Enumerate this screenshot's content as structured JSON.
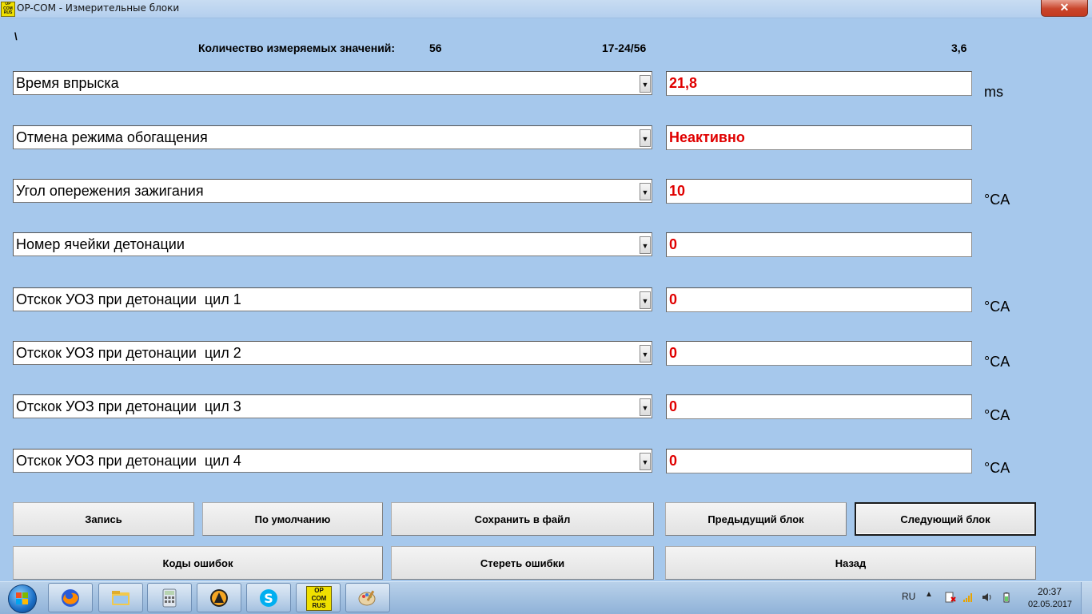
{
  "window": {
    "title": "OP-COM - Измерительные блоки",
    "icon_lines": [
      "OP",
      "COM",
      "RUS"
    ],
    "close_glyph": "✕"
  },
  "header": {
    "path": "\\",
    "count_label": "Количество измеряемых значений:",
    "count_value": "56",
    "range": "17-24/56",
    "version": "3,6"
  },
  "rows": [
    {
      "label": "Время впрыска",
      "value": "21,8",
      "unit": "ms"
    },
    {
      "label": "Отмена режима обогащения",
      "value": "Неактивно",
      "unit": ""
    },
    {
      "label": "Угол опережения зажигания",
      "value": "10",
      "unit": "°CA"
    },
    {
      "label": "Номер ячейки детонации",
      "value": "0",
      "unit": ""
    },
    {
      "label": "Отскок УОЗ при детонации  цил 1",
      "value": "0",
      "unit": "°CA"
    },
    {
      "label": "Отскок УОЗ при детонации  цил 2",
      "value": "0",
      "unit": "°CA"
    },
    {
      "label": "Отскок УОЗ при детонации  цил 3",
      "value": "0",
      "unit": "°CA"
    },
    {
      "label": "Отскок УОЗ при детонации  цил 4",
      "value": "0",
      "unit": "°CA"
    }
  ],
  "buttons": {
    "record": "Запись",
    "default": "По умолчанию",
    "save_file": "Сохранить в файл",
    "prev_block": "Предыдущий блок",
    "next_block": "Следующий блок",
    "error_codes": "Коды ошибок",
    "clear_errors": "Стереть ошибки",
    "back": "Назад"
  },
  "taskbar": {
    "apps": [
      "firefox-icon",
      "file-explorer-icon",
      "calculator-icon",
      "aimp-icon",
      "skype-icon",
      "opcom-icon",
      "paint-icon"
    ],
    "opcom_lines": [
      "OP",
      "COM",
      "RUS"
    ],
    "language": "RU",
    "time": "20:37",
    "date": "02.05.2017"
  },
  "colors": {
    "background": "#a6c8ec",
    "value_text": "#e00000"
  }
}
